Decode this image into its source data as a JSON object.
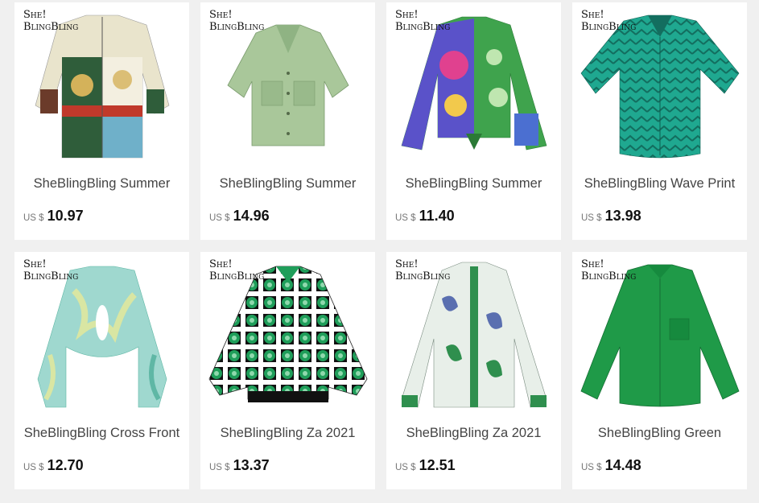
{
  "brand_logo": {
    "line1": "She!",
    "line2": "BlingBling"
  },
  "products": [
    {
      "title": "SheBlingBling Summer",
      "currency": "US $",
      "price": "10.97",
      "image": "patchwork-print-shirt",
      "colors": [
        "#e9e4cc",
        "#2f5d3a",
        "#c0392b",
        "#6fb0c9"
      ]
    },
    {
      "title": "SheBlingBling Summer",
      "currency": "US $",
      "price": "14.96",
      "image": "sage-crop-shirt",
      "colors": [
        "#a9c79a",
        "#8fb383"
      ]
    },
    {
      "title": "SheBlingBling Summer",
      "currency": "US $",
      "price": "11.40",
      "image": "paisley-patchwork-shirt",
      "colors": [
        "#3fa34d",
        "#5a52c9",
        "#e0418f",
        "#f2c94c"
      ]
    },
    {
      "title": "SheBlingBling Wave Print",
      "currency": "US $",
      "price": "13.98",
      "image": "teal-zigzag-shirt",
      "colors": [
        "#1fa890",
        "#136e5f"
      ]
    },
    {
      "title": "SheBlingBling Cross Front",
      "currency": "US $",
      "price": "12.70",
      "image": "marble-crop-top",
      "colors": [
        "#9fd8cf",
        "#d9e6a3",
        "#5fb7a5"
      ]
    },
    {
      "title": "SheBlingBling Za 2021",
      "currency": "US $",
      "price": "13.37",
      "image": "geometric-print-shirt",
      "colors": [
        "#1f9e5a",
        "#ffffff",
        "#111111"
      ]
    },
    {
      "title": "SheBlingBling Za 2021",
      "currency": "US $",
      "price": "12.51",
      "image": "paisley-placket-shirt",
      "colors": [
        "#e8efe9",
        "#2f8f4e",
        "#5a6fb0"
      ]
    },
    {
      "title": "SheBlingBling Green",
      "currency": "US $",
      "price": "14.48",
      "image": "green-satin-shirt",
      "colors": [
        "#1f9a48",
        "#168a3e"
      ]
    }
  ]
}
